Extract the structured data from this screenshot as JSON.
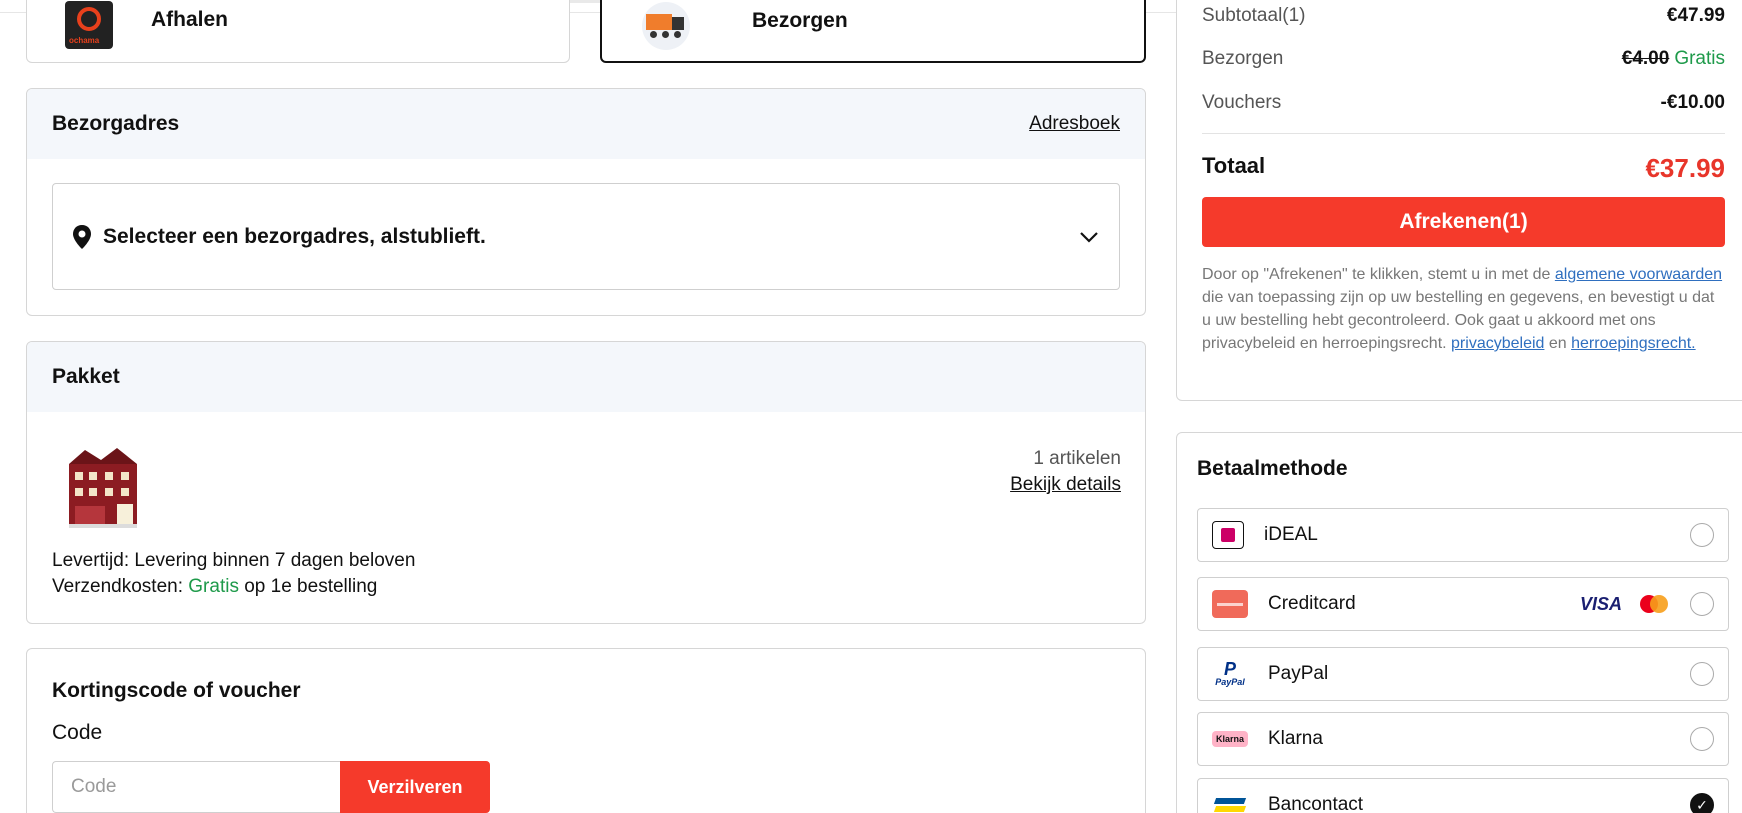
{
  "delivery_modes": {
    "pickup": {
      "label": "Afhalen",
      "brand": "ochama"
    },
    "delivery": {
      "label": "Bezorgen"
    }
  },
  "address": {
    "title": "Bezorgadres",
    "address_book_link": "Adresboek",
    "select_placeholder": "Selecteer een bezorgadres, alstublieft."
  },
  "package": {
    "title": "Pakket",
    "item_count": "1 artikelen",
    "details_link": "Bekijk details",
    "delivery_time_label": "Levertijd:",
    "delivery_time_value": "Levering binnen 7 dagen beloven",
    "shipping_label": "Verzendkosten:",
    "shipping_value": "Gratis",
    "shipping_suffix": "op 1e bestelling"
  },
  "voucher": {
    "title": "Kortingscode of voucher",
    "code_label": "Code",
    "input_placeholder": "Code",
    "redeem_label": "Verzilveren"
  },
  "summary": {
    "subtotal_label": "Subtotaal(1)",
    "subtotal_value": "€47.99",
    "delivery_label": "Bezorgen",
    "delivery_old": "€4.00",
    "delivery_value": "Gratis",
    "vouchers_label": "Vouchers",
    "vouchers_value": "-€10.00",
    "total_label": "Totaal",
    "total_value": "€37.99",
    "checkout_label": "Afrekenen(1)",
    "legal_1": "Door op \"Afrekenen\" te klikken, stemt u in met de ",
    "legal_link_terms": "algemene voorwaarden",
    "legal_2": " die van toepassing zijn op uw bestelling en gegevens, en bevestigt u dat u uw bestelling hebt gecontroleerd. Ook gaat u akkoord met ons privacybeleid en herroepingsrecht. ",
    "legal_link_privacy": "privacybeleid",
    "legal_3": " en ",
    "legal_link_withdrawal": "herroepingsrecht."
  },
  "payment": {
    "title": "Betaalmethode",
    "methods": [
      {
        "label": "iDEAL",
        "icon": "ideal-logo-icon",
        "selected": false
      },
      {
        "label": "Creditcard",
        "icon": "creditcard-icon",
        "selected": false,
        "brands": [
          "VISA",
          "mastercard"
        ]
      },
      {
        "label": "PayPal",
        "icon": "paypal-logo-icon",
        "selected": false,
        "logo_text": "PayPal"
      },
      {
        "label": "Klarna",
        "icon": "klarna-logo-icon",
        "selected": false,
        "logo_text": "Klarna"
      },
      {
        "label": "Bancontact",
        "icon": "bancontact-logo-icon",
        "selected": true
      }
    ]
  },
  "colors": {
    "accent_red": "#f53a2b",
    "total_red": "#e8352a",
    "green": "#1e9a4a",
    "link_blue": "#2f6fbf",
    "panel_header": "#f4f7fb"
  }
}
